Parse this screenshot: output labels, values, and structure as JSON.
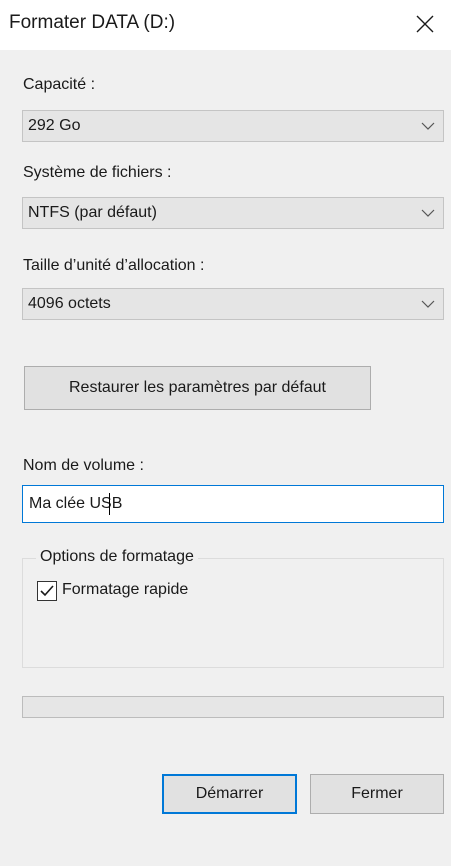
{
  "window": {
    "title": "Formater DATA (D:)",
    "close_icon": "close-icon"
  },
  "capacity": {
    "label": "Capacité :",
    "value": "292 Go"
  },
  "filesystem": {
    "label": "Système de fichiers :",
    "value": "NTFS (par défaut)"
  },
  "allocation": {
    "label": "Taille d’unité d’allocation :",
    "value": "4096 octets"
  },
  "restore_button": {
    "label": "Restaurer les paramètres par défaut"
  },
  "volume": {
    "label": "Nom de volume :",
    "value": "Ma clée USB"
  },
  "format_options": {
    "legend": "Options de formatage",
    "quick_format": {
      "label": "Formatage rapide",
      "checked": true
    }
  },
  "progress": {
    "fraction": 0
  },
  "buttons": {
    "start": "Démarrer",
    "close": "Fermer"
  },
  "colors": {
    "accent": "#0078d7",
    "progress": "#06b025"
  }
}
